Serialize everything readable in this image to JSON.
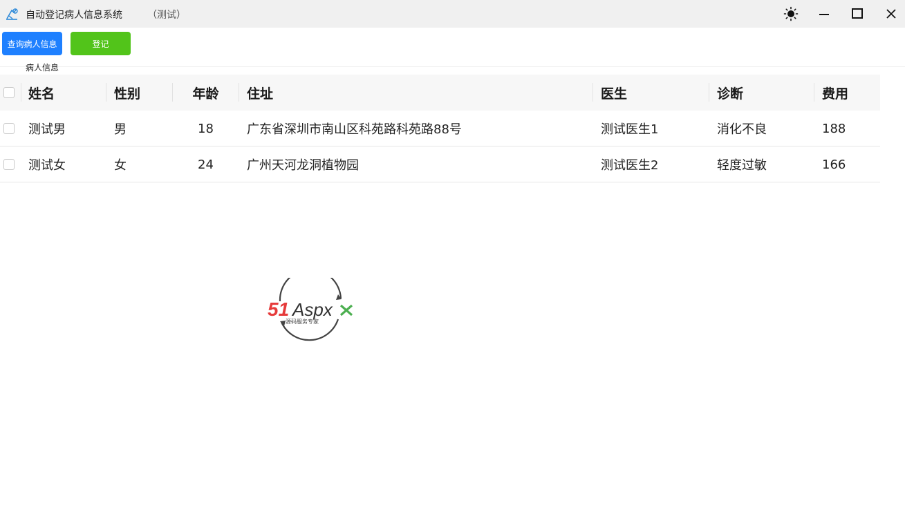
{
  "window": {
    "title": "自动登记病人信息系统",
    "subtitle": "（测试）",
    "icons": {
      "app": "app-icon",
      "theme": "sun-icon",
      "minimize": "minimize-icon",
      "maximize": "maximize-icon",
      "close": "close-icon"
    }
  },
  "toolbar": {
    "query_label": "查询病人信息",
    "register_label": "登记"
  },
  "section": {
    "label": "病人信息"
  },
  "table": {
    "columns": [
      "姓名",
      "性别",
      "年龄",
      "住址",
      "医生",
      "诊断",
      "费用"
    ],
    "rows": [
      {
        "name": "测试男",
        "gender": "男",
        "age": "18",
        "address": "广东省深圳市南山区科苑路科苑路88号",
        "doctor": "测试医生1",
        "diagnosis": "消化不良",
        "fee": "188"
      },
      {
        "name": "测试女",
        "gender": "女",
        "age": "24",
        "address": "广州天河龙洞植物园",
        "doctor": "测试医生2",
        "diagnosis": "轻度过敏",
        "fee": "166"
      }
    ]
  },
  "watermark": {
    "brand": "51Aspx",
    "tagline": "源码服务专家"
  },
  "colors": {
    "primary": "#1e80ff",
    "success": "#52c41a",
    "titlebar": "#f0f0f0",
    "header_bg": "#f7f7f7",
    "watermark_red": "#e63b3b",
    "watermark_green": "#4caf50"
  }
}
